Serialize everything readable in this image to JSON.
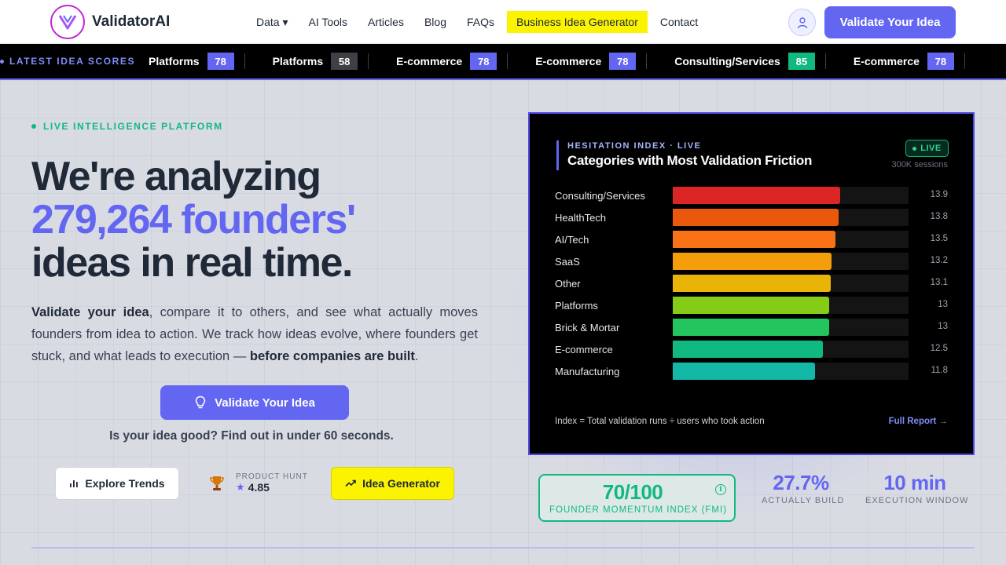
{
  "nav": {
    "brand": "ValidatorAI",
    "links": [
      {
        "label": "Data ▾"
      },
      {
        "label": "AI Tools"
      },
      {
        "label": "Articles"
      },
      {
        "label": "Blog"
      },
      {
        "label": "FAQs"
      },
      {
        "label": "Business Idea Generator",
        "highlight": true
      },
      {
        "label": "Contact"
      }
    ],
    "cta": "Validate Your Idea",
    "colors": {
      "accent": "#6366f1",
      "highlight": "#fcf300",
      "logo_ring": "#c026d3"
    }
  },
  "ticker": {
    "label": "LATEST IDEA SCORES",
    "items": [
      {
        "name": "Platforms",
        "score": "78",
        "color": "#6366f1"
      },
      {
        "name": "Platforms",
        "score": "58",
        "color": "#3f3f46"
      },
      {
        "name": "E-commerce",
        "score": "78",
        "color": "#6366f1"
      },
      {
        "name": "E-commerce",
        "score": "78",
        "color": "#6366f1"
      },
      {
        "name": "Consulting/Services",
        "score": "85",
        "color": "#10b981"
      },
      {
        "name": "E-commerce",
        "score": "78",
        "color": "#6366f1"
      }
    ]
  },
  "hero": {
    "eyebrow": "LIVE INTELLIGENCE PLATFORM",
    "headline_1": "We're analyzing",
    "headline_2": "279,264 founders'",
    "headline_3": "ideas in real time.",
    "desc_bold_1": "Validate your idea",
    "desc_mid": ", compare it to others, and see what actually moves founders from idea to action. We track how ideas evolve, where founders get stuck, and what leads to execution — ",
    "desc_bold_2": "before companies are built",
    "desc_end": ".",
    "cta": "Validate Your Idea",
    "sub": "Is your idea good? Find out in under 60 seconds.",
    "explore": "Explore Trends",
    "ph_label": "PRODUCT HUNT",
    "ph_value": "4.85",
    "generator": "Idea Generator"
  },
  "panel": {
    "eyebrow": "HESITATION INDEX · LIVE",
    "title": "Categories with Most Validation Friction",
    "live": "LIVE",
    "sessions": "300K sessions",
    "footnote": "Index = Total validation runs ÷ users who took action",
    "link": "Full Report →"
  },
  "chart_data": {
    "type": "bar",
    "orientation": "horizontal",
    "title": "Categories with Most Validation Friction",
    "categories": [
      "Consulting/Services",
      "HealthTech",
      "AI/Tech",
      "SaaS",
      "Other",
      "Platforms",
      "Brick & Mortar",
      "E-commerce",
      "Manufacturing"
    ],
    "values": [
      13.9,
      13.8,
      13.5,
      13.2,
      13.1,
      13,
      13,
      12.5,
      11.8
    ],
    "value_labels": [
      "13.9",
      "13.8",
      "13.5",
      "13.2",
      "13.1",
      "13",
      "13",
      "12.5",
      "11.8"
    ],
    "xlim": [
      0,
      19.6
    ],
    "colors": [
      "#dc2626",
      "#ea580c",
      "#f97316",
      "#f59e0b",
      "#eab308",
      "#84cc16",
      "#22c55e",
      "#10b981",
      "#14b8a6"
    ]
  },
  "stats": {
    "fmi_value": "70/100",
    "fmi_label": "FOUNDER MOMENTUM INDEX (FMI)",
    "fmi_info": "i",
    "build_value": "27.7%",
    "build_label": "ACTUALLY BUILD",
    "window_value": "10 min",
    "window_label": "EXECUTION WINDOW"
  }
}
